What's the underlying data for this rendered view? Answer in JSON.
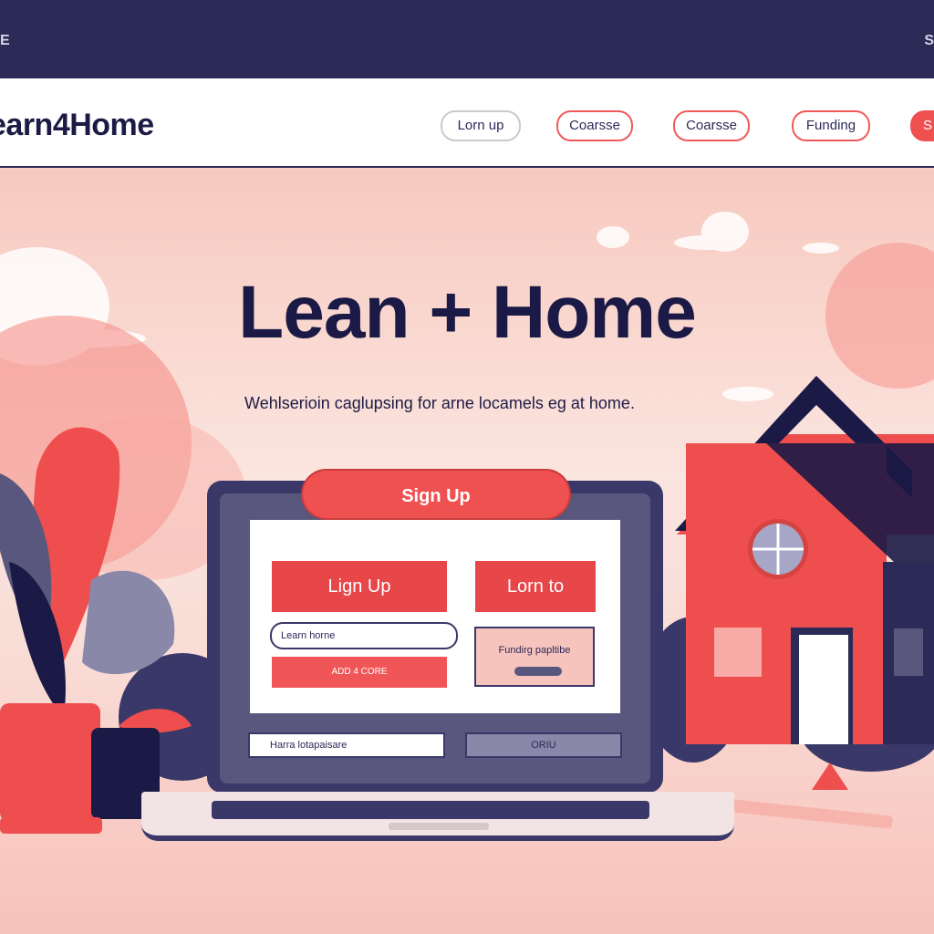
{
  "topbar": {
    "left_edge": "E",
    "right_edge": "S"
  },
  "nav": {
    "logo": "earn4Home",
    "links": [
      "Lorn up",
      "Coarsse",
      "Coarsse",
      "Funding"
    ],
    "cta_edge": "S"
  },
  "hero": {
    "headline": "Lean + Home",
    "tagline": "Wehlserioin caglupsing for arne locamels eg at home."
  },
  "laptop": {
    "signup_pill": "Sign Up",
    "signup_button": "Lign Up",
    "login_button": "Lorn to",
    "input_value": "Learn horne",
    "action_bar": "ADD 4 CORE",
    "funding_label": "Fundirg papltibe",
    "bottom_field": "Harra lotapaisare",
    "bottom_button": "ORIU"
  },
  "colors": {
    "accent": "#ef5050",
    "navy": "#2c2a57",
    "blush": "#f7cfc6"
  }
}
